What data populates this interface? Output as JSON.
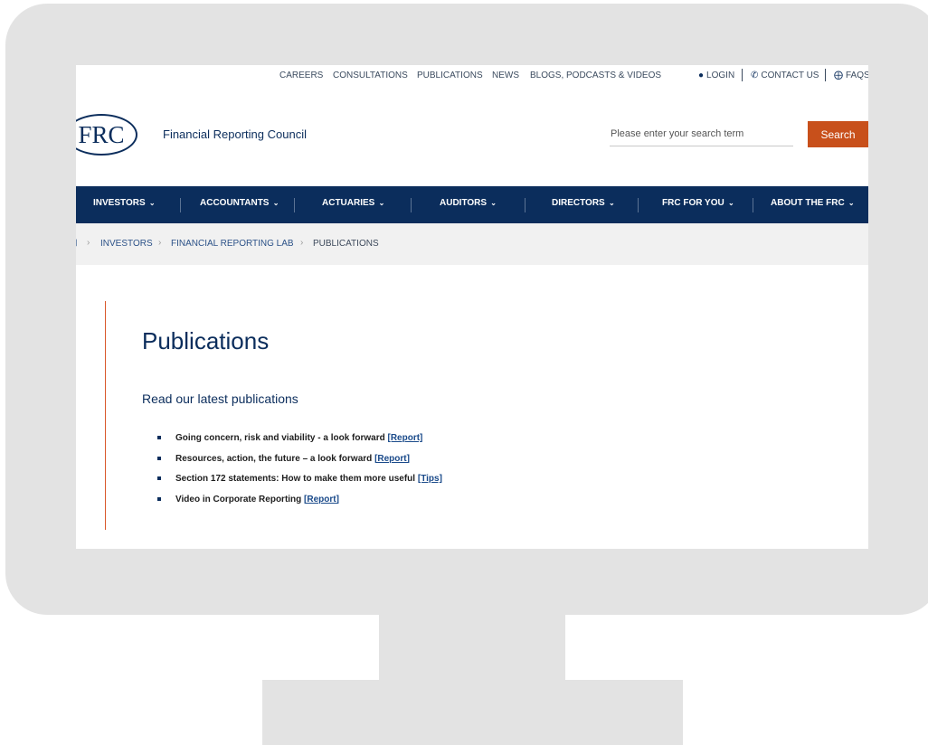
{
  "utility_nav": {
    "links": [
      "CAREERS",
      "CONSULTATIONS",
      "PUBLICATIONS",
      "NEWS",
      "BLOGS, PODCASTS & VIDEOS"
    ],
    "login": "LOGIN",
    "contact": "CONTACT US",
    "faqs": "FAQS"
  },
  "header": {
    "logo_text": "FRC",
    "org_name": "Financial Reporting Council",
    "search_placeholder": "Please enter your search term",
    "search_button": "Search"
  },
  "main_nav": {
    "items": [
      "INVESTORS",
      "ACCOUNTANTS",
      "ACTUARIES",
      "AUDITORS",
      "DIRECTORS",
      "FRC FOR YOU",
      "ABOUT THE FRC"
    ]
  },
  "breadcrumb": {
    "items": [
      "INVESTORS",
      "FINANCIAL REPORTING LAB",
      "PUBLICATIONS"
    ]
  },
  "content": {
    "title": "Publications",
    "subtitle": "Read our latest publications",
    "publications": [
      {
        "text": "Going concern, risk and viability - a look forward ",
        "link_text": "[Report]"
      },
      {
        "text": "Resources, action, the future – a look forward ",
        "link_text": "[Report]"
      },
      {
        "text": "Section 172 statements: How to make them more useful ",
        "link_text": "[Tips]"
      },
      {
        "text": "Video in Corporate Reporting ",
        "link_text": "[Report]"
      }
    ]
  },
  "colors": {
    "brand_navy": "#0b2d5c",
    "accent_orange": "#c8501b",
    "monitor_gray": "#e3e3e3"
  },
  "icons": [
    "user-icon",
    "phone-icon",
    "lifebuoy-icon",
    "chevron-down-icon",
    "chevron-right-icon",
    "home-icon",
    "square-bullet-icon"
  ]
}
